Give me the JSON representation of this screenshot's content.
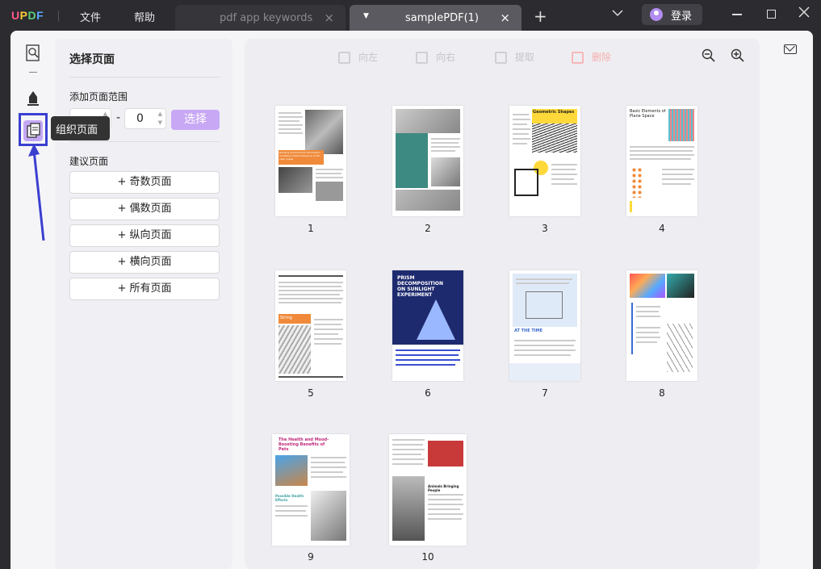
{
  "app": {
    "logo": "UPDF",
    "logo_u": "U",
    "logo_p": "P",
    "logo_d": "D",
    "logo_f": "F",
    "menu": [
      "文件",
      "帮助"
    ]
  },
  "tabs": [
    {
      "label": "pdf app keywords",
      "active": false
    },
    {
      "label": "samplePDF(1)",
      "active": true
    }
  ],
  "titlebar": {
    "new_tab": "+",
    "login_label": "登录"
  },
  "lefttool": {
    "tooltip": "组织页面"
  },
  "panel": {
    "title": "选择页面",
    "range_label": "添加页面范围",
    "range_from": "",
    "range_to": "0",
    "range_dash": "-",
    "select_button": "选择",
    "suggest_label": "建议页面",
    "suggest_buttons": [
      "+ 奇数页面",
      "+ 偶数页面",
      "+ 纵向页面",
      "+ 横向页面",
      "+ 所有页面"
    ]
  },
  "toolbar": {
    "rotate_left": "向左",
    "rotate_right": "向右",
    "extract": "提取",
    "delete": "删除"
  },
  "pages": [
    "1",
    "2",
    "3",
    "4",
    "5",
    "6",
    "7",
    "8",
    "9",
    "10"
  ],
  "thumb_text": {
    "p1": "Building environment information modeling method based on multi-view image",
    "p3": "Geometric Shapes",
    "p4": "Basic Elements of Plane Space",
    "p5": "String",
    "p6": "PRISM DECOMPOSITION ON SUNLIGHT EXPERIMENT",
    "p7": "AT THE TIME",
    "p9": "The Health and Mood-Boosting Benefits of Pets",
    "p9b": "Possible Health Effects",
    "p10": "Animals Bringing People"
  },
  "colors": {
    "accent": "#c8a8f5",
    "highlight_box": "#3a3fd0",
    "arrow": "#3a3fd0"
  }
}
